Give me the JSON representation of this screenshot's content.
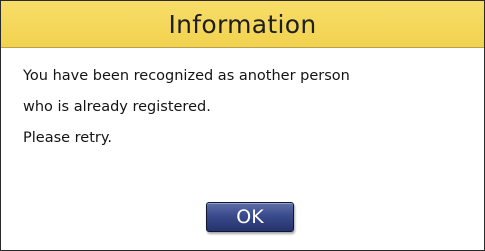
{
  "dialog": {
    "title": "Information",
    "message_lines": [
      "You have been recognized as another person",
      "who is already registered.",
      "Please retry."
    ],
    "ok_label": "OK"
  },
  "colors": {
    "header_background": "#f2d24f",
    "button_background": "#3a4b8c",
    "button_text": "#ffffff"
  }
}
